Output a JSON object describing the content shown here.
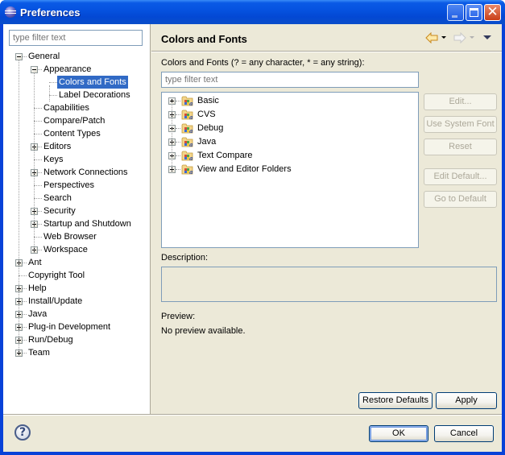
{
  "window": {
    "title": "Preferences",
    "controls": [
      "minimize",
      "maximize",
      "close"
    ]
  },
  "left": {
    "filter_placeholder": "type filter text",
    "tree": [
      {
        "label": "General",
        "level": 0,
        "expander": "minus"
      },
      {
        "label": "Appearance",
        "level": 1,
        "expander": "minus"
      },
      {
        "label": "Colors and Fonts",
        "level": 2,
        "expander": "none",
        "selected": true
      },
      {
        "label": "Label Decorations",
        "level": 2,
        "expander": "none"
      },
      {
        "label": "Capabilities",
        "level": 1,
        "expander": "none"
      },
      {
        "label": "Compare/Patch",
        "level": 1,
        "expander": "none"
      },
      {
        "label": "Content Types",
        "level": 1,
        "expander": "none"
      },
      {
        "label": "Editors",
        "level": 1,
        "expander": "plus"
      },
      {
        "label": "Keys",
        "level": 1,
        "expander": "none"
      },
      {
        "label": "Network Connections",
        "level": 1,
        "expander": "plus"
      },
      {
        "label": "Perspectives",
        "level": 1,
        "expander": "none"
      },
      {
        "label": "Search",
        "level": 1,
        "expander": "none"
      },
      {
        "label": "Security",
        "level": 1,
        "expander": "plus"
      },
      {
        "label": "Startup and Shutdown",
        "level": 1,
        "expander": "plus"
      },
      {
        "label": "Web Browser",
        "level": 1,
        "expander": "none"
      },
      {
        "label": "Workspace",
        "level": 1,
        "expander": "plus"
      },
      {
        "label": "Ant",
        "level": 0,
        "expander": "plus"
      },
      {
        "label": "Copyright Tool",
        "level": 0,
        "expander": "none"
      },
      {
        "label": "Help",
        "level": 0,
        "expander": "plus"
      },
      {
        "label": "Install/Update",
        "level": 0,
        "expander": "plus"
      },
      {
        "label": "Java",
        "level": 0,
        "expander": "plus"
      },
      {
        "label": "Plug-in Development",
        "level": 0,
        "expander": "plus"
      },
      {
        "label": "Run/Debug",
        "level": 0,
        "expander": "plus"
      },
      {
        "label": "Team",
        "level": 0,
        "expander": "plus"
      }
    ]
  },
  "page": {
    "title": "Colors and Fonts",
    "nav": {
      "back": "back-arrow",
      "forward": "forward-arrow",
      "menu": "view-menu"
    },
    "filter_label": "Colors and Fonts (? = any character, * = any string):",
    "filter_placeholder": "type filter text",
    "categories": [
      {
        "label": "Basic"
      },
      {
        "label": "CVS"
      },
      {
        "label": "Debug"
      },
      {
        "label": "Java"
      },
      {
        "label": "Text Compare"
      },
      {
        "label": "View and Editor Folders"
      }
    ],
    "side_buttons": [
      {
        "label": "Edit...",
        "enabled": false
      },
      {
        "label": "Use System Font",
        "enabled": false
      },
      {
        "label": "Reset",
        "enabled": false
      },
      {
        "label": "Edit Default...",
        "enabled": false
      },
      {
        "label": "Go to Default",
        "enabled": false
      }
    ],
    "description_label": "Description:",
    "description_value": "",
    "preview_label": "Preview:",
    "preview_text": "No preview available.",
    "restore_defaults": "Restore Defaults",
    "apply": "Apply"
  },
  "footer": {
    "help_glyph": "?",
    "ok": "OK",
    "cancel": "Cancel"
  },
  "colors": {
    "selection": "#316ac5",
    "titlebar": "#0653e0",
    "dialog_bg": "#ece9d8"
  }
}
